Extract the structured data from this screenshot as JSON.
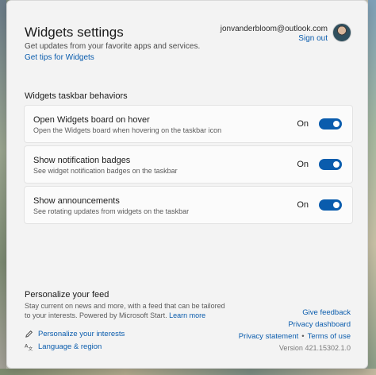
{
  "header": {
    "title": "Widgets settings",
    "subtitle": "Get updates from your favorite apps and services.",
    "tips_link": "Get tips for Widgets",
    "account_email": "jonvanderbloom@outlook.com",
    "sign_out": "Sign out"
  },
  "taskbar_section": {
    "title": "Widgets taskbar behaviors",
    "items": [
      {
        "label": "Open Widgets board on hover",
        "description": "Open the Widgets board when hovering on the taskbar icon",
        "state": "On",
        "toggle_on": true
      },
      {
        "label": "Show notification badges",
        "description": "See widget notification badges on the taskbar",
        "state": "On",
        "toggle_on": true
      },
      {
        "label": "Show announcements",
        "description": "See rotating updates from widgets on the taskbar",
        "state": "On",
        "toggle_on": true
      }
    ]
  },
  "feed_section": {
    "title": "Personalize your feed",
    "description": "Stay current on news and more, with a feed that can be tailored to your interests. Powered by Microsoft Start.",
    "learn_more": "Learn more",
    "personalize_interests": "Personalize your interests",
    "language_region": "Language & region"
  },
  "footer": {
    "give_feedback": "Give feedback",
    "privacy_dashboard": "Privacy dashboard",
    "privacy_statement": "Privacy statement",
    "separator": "•",
    "terms_of_use": "Terms of use",
    "version": "Version 421.15302.1.0"
  },
  "colors": {
    "accent": "#0a5cad",
    "dialog_background": "#f3f3f3",
    "card_background": "#fbfbfb"
  }
}
